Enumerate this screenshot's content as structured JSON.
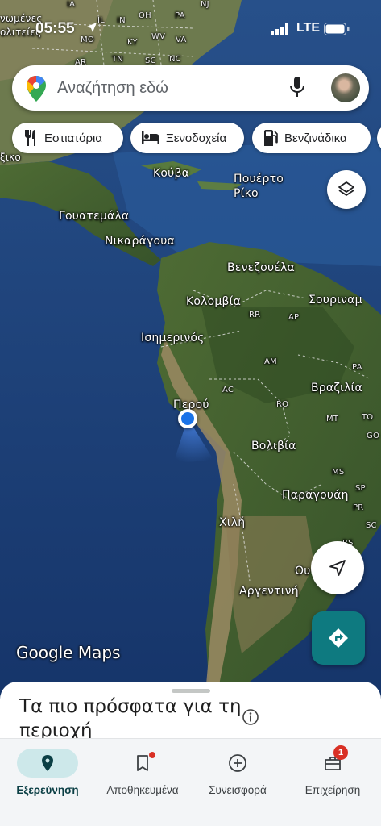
{
  "status_bar": {
    "time": "05:55",
    "network": "LTE"
  },
  "search": {
    "placeholder": "Αναζήτηση εδώ"
  },
  "chips": [
    {
      "label": "Εστιατόρια",
      "icon": "restaurant-icon"
    },
    {
      "label": "Ξενοδοχεία",
      "icon": "hotel-icon"
    },
    {
      "label": "Βενζινάδικα",
      "icon": "gas-station-icon"
    }
  ],
  "map": {
    "countries": {
      "cuba": "Κούβα",
      "puerto_rico": "Πουέρτο\nΡίκο",
      "guatemala": "Γουατεμάλα",
      "nicaragua": "Νικαράγουα",
      "venezuela": "Βενεζουέλα",
      "colombia": "Κολομβία",
      "suriname": "Σουριναμ",
      "ecuador": "Ισημερινός",
      "peru": "Περού",
      "bolivia": "Βολιβία",
      "brazil": "Βραζιλία",
      "paraguay": "Παραγουάη",
      "chile": "Χιλή",
      "argentina": "Αργεντινή",
      "uruguay": "Ου",
      "mexico_partial": "ξικο",
      "us_partial_1": "νωμένες",
      "us_partial_2": "ολιτείες"
    },
    "state_codes": [
      "IA",
      "IN",
      "OH",
      "PA",
      "NJ",
      "IL",
      "KY",
      "WV",
      "VA",
      "MO",
      "AR",
      "TN",
      "NC",
      "SC",
      "RR",
      "AP",
      "AM",
      "PA",
      "AC",
      "RO",
      "MT",
      "TO",
      "GO",
      "MS",
      "SP",
      "PR",
      "SC",
      "RS"
    ],
    "attribution": "Google Maps"
  },
  "bottom_sheet": {
    "title": "Τα πιο πρόσφατα για τη περιοχή"
  },
  "nav": [
    {
      "label": "Εξερεύνηση",
      "icon": "explore-pin-icon",
      "active": true
    },
    {
      "label": "Αποθηκευμένα",
      "icon": "bookmark-icon",
      "dot": true
    },
    {
      "label": "Συνεισφορά",
      "icon": "add-circle-icon"
    },
    {
      "label": "Επιχείρηση",
      "icon": "business-icon",
      "badge": "1"
    }
  ],
  "colors": {
    "accent": "#0e7a80",
    "active_pill": "#cde8ea",
    "location_dot": "#1a73e8",
    "badge": "#d93025"
  }
}
